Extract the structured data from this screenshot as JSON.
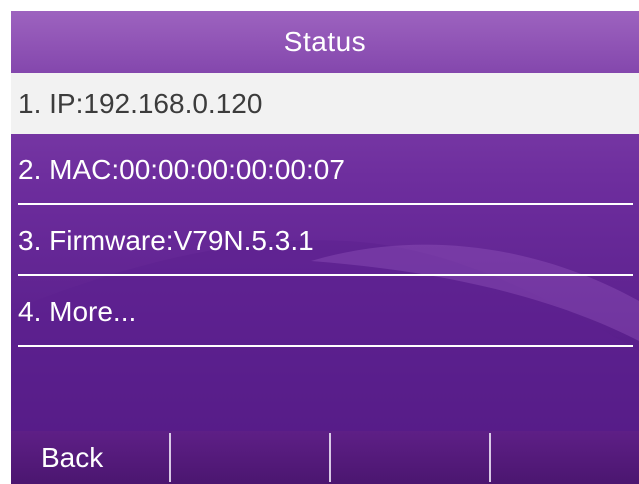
{
  "screen": {
    "title": "Status",
    "colors": {
      "background": "#6e2e9e",
      "title_bar": "#8f53b5",
      "selected_row": "#f2f2f2",
      "text": "#ffffff",
      "selected_text": "#3c3c3c"
    }
  },
  "menu": {
    "items": [
      {
        "label": "1. IP:192.168.0.120",
        "selected": true
      },
      {
        "label": "2. MAC:00:00:00:00:00:07",
        "selected": false
      },
      {
        "label": "3. Firmware:V79N.5.3.1",
        "selected": false
      },
      {
        "label": "4. More...",
        "selected": false
      }
    ]
  },
  "softkeys": [
    {
      "label": "Back"
    },
    {
      "label": ""
    },
    {
      "label": ""
    },
    {
      "label": ""
    }
  ]
}
